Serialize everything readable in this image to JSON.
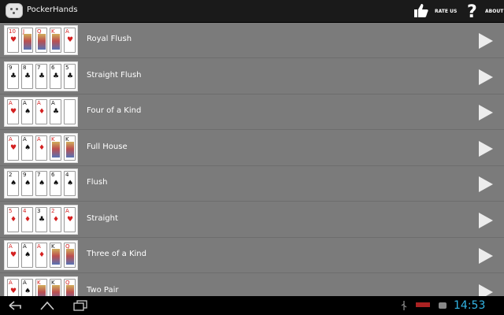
{
  "app": {
    "title": "PockerHands",
    "icon": "poker-cards-icon"
  },
  "actions": {
    "rate_label": "RATE US",
    "rate_icon": "thumbs-up-icon",
    "about_label": "ABOUT",
    "about_icon": "question-mark-icon"
  },
  "hands": [
    {
      "label": "Royal Flush",
      "cards": [
        [
          "10",
          "♥",
          "red"
        ],
        [
          "J",
          "♥",
          "red"
        ],
        [
          "Q",
          "♥",
          "red"
        ],
        [
          "K",
          "♥",
          "red"
        ],
        [
          "A",
          "♥",
          "red"
        ]
      ]
    },
    {
      "label": "Straight Flush",
      "cards": [
        [
          "9",
          "♣",
          "black"
        ],
        [
          "8",
          "♣",
          "black"
        ],
        [
          "7",
          "♣",
          "black"
        ],
        [
          "6",
          "♣",
          "black"
        ],
        [
          "5",
          "♣",
          "black"
        ]
      ]
    },
    {
      "label": "Four of a Kind",
      "cards": [
        [
          "A",
          "♥",
          "red"
        ],
        [
          "A",
          "♠",
          "black"
        ],
        [
          "A",
          "♦",
          "red"
        ],
        [
          "A",
          "♣",
          "black"
        ],
        [
          "",
          "",
          "black"
        ]
      ]
    },
    {
      "label": "Full House",
      "cards": [
        [
          "A",
          "♥",
          "red"
        ],
        [
          "A",
          "♠",
          "black"
        ],
        [
          "A",
          "♦",
          "red"
        ],
        [
          "K",
          "♥",
          "red"
        ],
        [
          "K",
          "♣",
          "black"
        ]
      ]
    },
    {
      "label": "Flush",
      "cards": [
        [
          "2",
          "♠",
          "black"
        ],
        [
          "9",
          "♠",
          "black"
        ],
        [
          "7",
          "♠",
          "black"
        ],
        [
          "6",
          "♠",
          "black"
        ],
        [
          "4",
          "♠",
          "black"
        ]
      ]
    },
    {
      "label": "Straight",
      "cards": [
        [
          "5",
          "♦",
          "red"
        ],
        [
          "4",
          "♦",
          "red"
        ],
        [
          "3",
          "♣",
          "black"
        ],
        [
          "2",
          "♦",
          "red"
        ],
        [
          "A",
          "♥",
          "red"
        ]
      ]
    },
    {
      "label": "Three of a Kind",
      "cards": [
        [
          "A",
          "♥",
          "red"
        ],
        [
          "A",
          "♠",
          "black"
        ],
        [
          "A",
          "♦",
          "red"
        ],
        [
          "K",
          "♣",
          "black"
        ],
        [
          "Q",
          "♦",
          "red"
        ]
      ]
    },
    {
      "label": "Two Pair",
      "cards": [
        [
          "A",
          "♥",
          "red"
        ],
        [
          "A",
          "♠",
          "black"
        ],
        [
          "K",
          "♥",
          "red"
        ],
        [
          "K",
          "♣",
          "black"
        ],
        [
          "Q",
          "♦",
          "red"
        ]
      ]
    }
  ],
  "row_button_icon": "play-arrow-icon",
  "system_bar": {
    "clock": "14:53",
    "nav_icons": [
      "back-icon",
      "home-icon",
      "recent-apps-icon"
    ],
    "status_icons": [
      "usb-icon",
      "notification-icon",
      "battery-icon"
    ]
  }
}
